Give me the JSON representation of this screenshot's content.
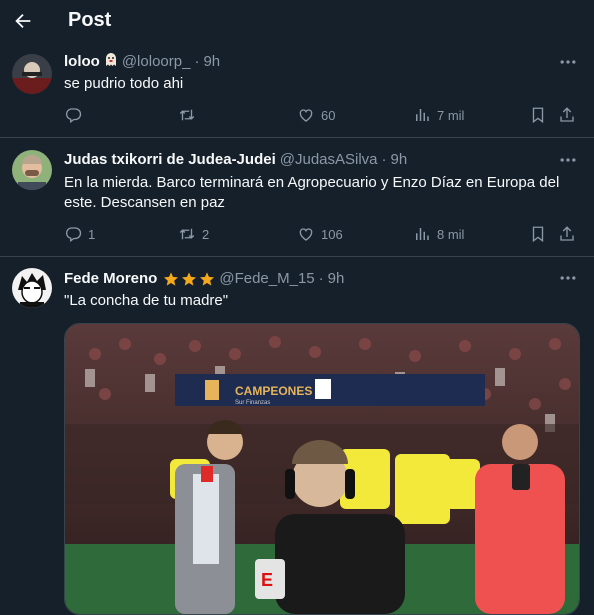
{
  "header": {
    "title": "Post"
  },
  "tweets": [
    {
      "name": "loloo",
      "handle": "@loloorp_",
      "time": "9h",
      "text": "se pudrio todo ahi",
      "replies": "",
      "retweets": "",
      "likes": "60",
      "views": "7 mil"
    },
    {
      "name": "Judas txikorri de Judea-Judei",
      "handle": "@JudasASilva",
      "time": "9h",
      "text": "En la mierda. Barco terminará en Agropecuario y Enzo Díaz en Europa del este. Descansen en paz",
      "replies": "1",
      "retweets": "2",
      "likes": "106",
      "views": "8 mil"
    },
    {
      "name": "Fede Moreno",
      "handle": "@Fede_M_15",
      "time": "9h",
      "text": "\"La concha de tu madre\""
    }
  ],
  "media": {
    "banner_text": "CAMPEONES",
    "banner_sub": "Sur Finanzas",
    "mic_logo": "E"
  },
  "colors": {
    "background": "#15202b",
    "text": "#f7f9f9",
    "muted": "#8b98a5",
    "divider": "#38444d",
    "star": "#f4a91c"
  }
}
